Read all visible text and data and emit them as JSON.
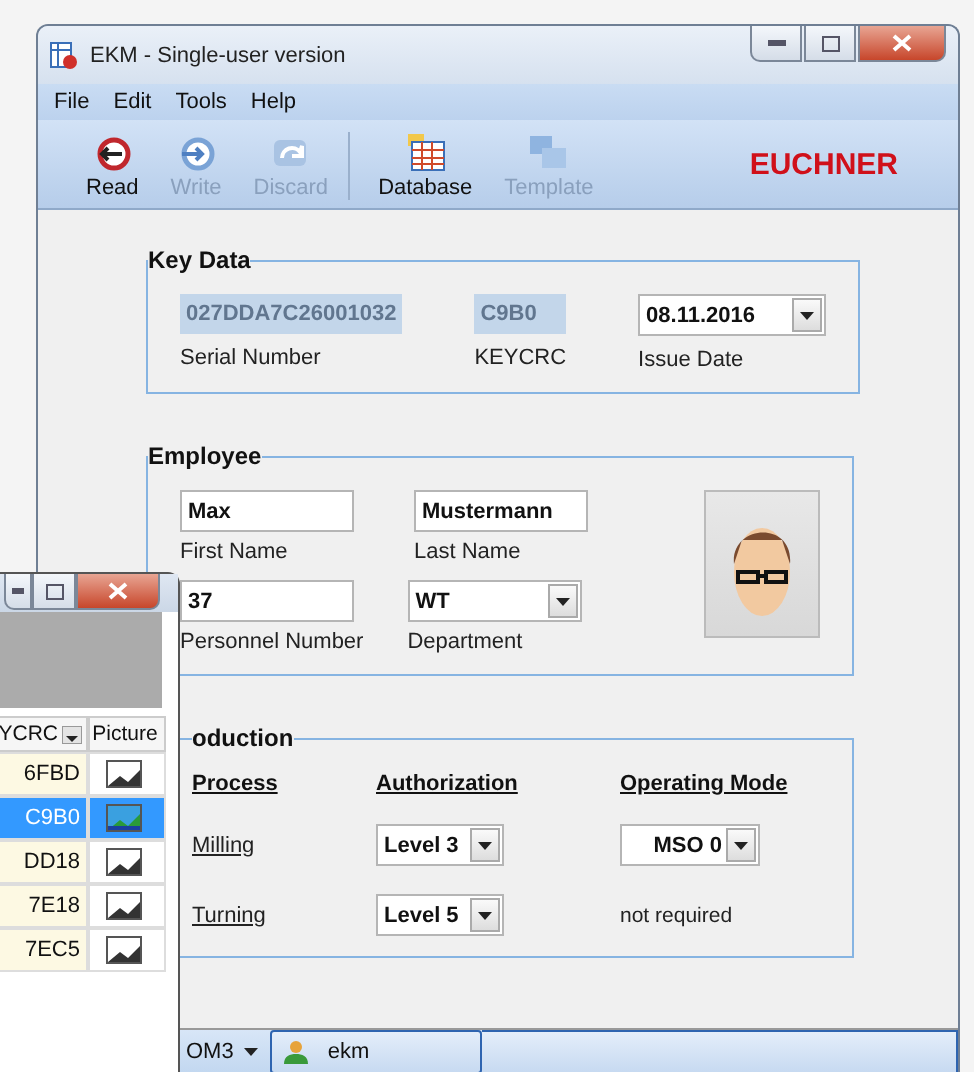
{
  "window": {
    "title": "EKM - Single-user version"
  },
  "menu": [
    "File",
    "Edit",
    "Tools",
    "Help"
  ],
  "toolbar": [
    {
      "kind": "read",
      "label": "Read",
      "disabled": false
    },
    {
      "kind": "write",
      "label": "Write",
      "disabled": true
    },
    {
      "kind": "discard",
      "label": "Discard",
      "disabled": true
    },
    {
      "kind": "database",
      "label": "Database",
      "disabled": false
    },
    {
      "kind": "template",
      "label": "Template",
      "disabled": true
    }
  ],
  "brand": "EUCHNER",
  "key_data": {
    "title": "Key Data",
    "fields": [
      {
        "kind": "readonly",
        "label": "Serial Number",
        "value": "027DDA7C26001032",
        "disabled": true
      },
      {
        "kind": "readonly",
        "label": "KEYCRC",
        "value": "C9B0",
        "disabled": true
      },
      {
        "kind": "dropdown",
        "label": "Issue Date",
        "value": "08.11.2016",
        "disabled": false
      }
    ]
  },
  "employee": {
    "title": "Employee",
    "fields": [
      {
        "kind": "text",
        "label": "First Name",
        "value": "Max"
      },
      {
        "kind": "text",
        "label": "Last Name",
        "value": "Mustermann"
      },
      {
        "kind": "text",
        "label": "Personnel Number",
        "value": "37"
      },
      {
        "kind": "dropdown",
        "label": "Department",
        "value": "WT"
      }
    ]
  },
  "production": {
    "title": "oduction",
    "headers": [
      "Process",
      "Authorization",
      "Operating Mode"
    ],
    "rows": [
      {
        "process": "Milling",
        "authorization": "Level 3",
        "mode": {
          "kind": "dropdown",
          "value": "MSO 0"
        }
      },
      {
        "process": "Turning",
        "authorization": "Level 5",
        "mode": {
          "kind": "text",
          "value": "not required"
        }
      }
    ]
  },
  "status_bar": {
    "port": "OM3",
    "user": "ekm"
  },
  "second_window": {
    "columns": [
      "YCRC",
      "Picture"
    ],
    "rows": [
      {
        "crc": "6FBD",
        "selected": false
      },
      {
        "crc": "C9B0",
        "selected": true
      },
      {
        "crc": "DD18",
        "selected": false
      },
      {
        "crc": "7E18",
        "selected": false
      },
      {
        "crc": "7EC5",
        "selected": false
      }
    ]
  }
}
